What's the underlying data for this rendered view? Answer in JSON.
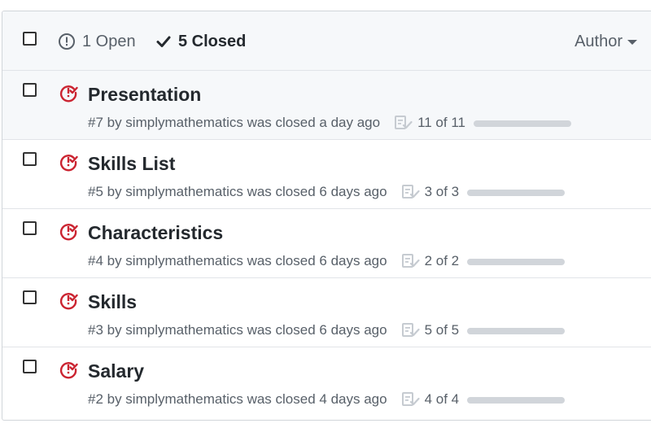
{
  "header": {
    "open_label": "1 Open",
    "closed_label": "5 Closed",
    "author_label": "Author"
  },
  "colors": {
    "closed_icon": "#cb2431",
    "progress_fill": "#d1d5da"
  },
  "issues": [
    {
      "title": "Presentation",
      "meta": "#7 by simplymathematics was closed a day ago",
      "tasks": "11 of 11",
      "progress": 1.0
    },
    {
      "title": "Skills List",
      "meta": "#5 by simplymathematics was closed 6 days ago",
      "tasks": "3 of 3",
      "progress": 1.0
    },
    {
      "title": "Characteristics",
      "meta": "#4 by simplymathematics was closed 6 days ago",
      "tasks": "2 of 2",
      "progress": 1.0
    },
    {
      "title": "Skills",
      "meta": "#3 by simplymathematics was closed 6 days ago",
      "tasks": "5 of 5",
      "progress": 1.0
    },
    {
      "title": "Salary",
      "meta": "#2 by simplymathematics was closed 4 days ago",
      "tasks": "4 of 4",
      "progress": 1.0
    }
  ]
}
